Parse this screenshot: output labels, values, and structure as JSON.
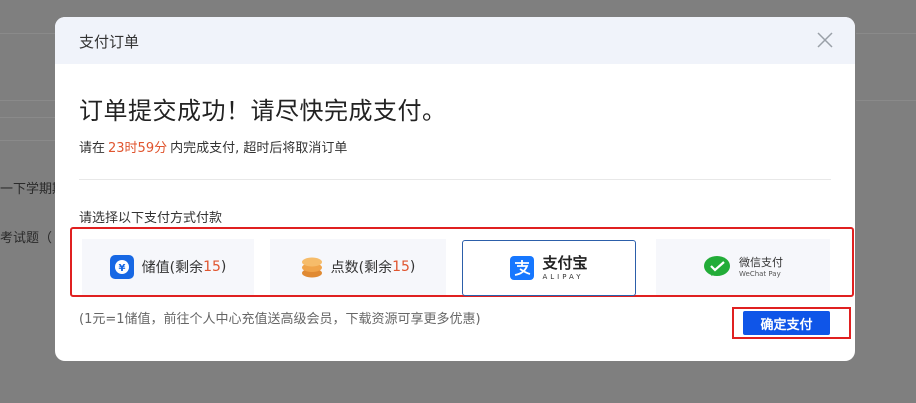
{
  "background": {
    "snippet_1": "一下学期期",
    "snippet_2": "考试题（"
  },
  "modal": {
    "title": "支付订单",
    "headline": "订单提交成功！请尽快完成支付。",
    "timer_prefix": "请在",
    "countdown": "23时59分",
    "timer_suffix": "内完成支付, 超时后将取消订单",
    "select_label": "请选择以下支付方式付款",
    "note": "(1元=1储值，前往个人中心充值送高级会员，下载资源可享更多优惠)",
    "confirm_label": "确定支付"
  },
  "payment_methods": [
    {
      "label": "储值(剩余",
      "count": "15",
      "suffix": ")",
      "icon": "stored-value-icon",
      "color": "#1768e4"
    },
    {
      "label": "点数(剩余",
      "count": "15",
      "suffix": ")",
      "icon": "coins-icon",
      "color": "#f0a44a"
    },
    {
      "label": "支付宝",
      "sublabel": "ALIPAY",
      "icon": "alipay-icon",
      "color": "#1677ff",
      "selected": true
    },
    {
      "label": "微信支付",
      "sublabel": "WeChat Pay",
      "icon": "wechat-pay-icon",
      "color": "#22ac38"
    }
  ],
  "colors": {
    "accent": "#0f55e8",
    "highlight_red": "#e0552f",
    "selected_border": "#2c5faa"
  }
}
